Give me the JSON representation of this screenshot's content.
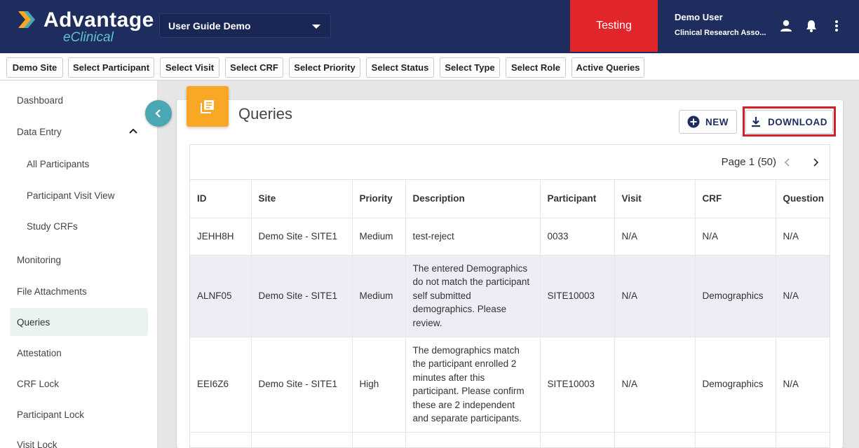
{
  "header": {
    "logo_main": "Advantage",
    "logo_sub": "eClinical",
    "study": "User Guide Demo",
    "environment": "Testing",
    "user_name": "Demo User",
    "user_role": "Clinical Research Asso...",
    "icons": [
      "person-icon",
      "bell-icon",
      "more-vert-icon"
    ],
    "colors": {
      "header_bg": "#1e2d5e",
      "env_bg": "#e0252b",
      "accent": "#4aa8b4"
    }
  },
  "filters": [
    "Demo Site",
    "Select Participant",
    "Select Visit",
    "Select CRF",
    "Select Priority",
    "Select Status",
    "Select Type",
    "Select Role",
    "Active Queries"
  ],
  "sidebar": {
    "items": [
      {
        "label": "Dashboard"
      },
      {
        "label": "Data Entry"
      },
      {
        "label": "All Participants"
      },
      {
        "label": "Participant Visit View"
      },
      {
        "label": "Study CRFs"
      },
      {
        "label": "Monitoring"
      },
      {
        "label": "File Attachments"
      },
      {
        "label": "Queries"
      },
      {
        "label": "Attestation"
      },
      {
        "label": "CRF Lock"
      },
      {
        "label": "Participant Lock"
      },
      {
        "label": "Visit Lock"
      }
    ],
    "active": "Queries"
  },
  "main": {
    "title": "Queries",
    "new_label": "NEW",
    "download_label": "DOWNLOAD",
    "pager": "Page 1 (50)"
  },
  "table": {
    "columns": [
      "ID",
      "Site",
      "Priority",
      "Description",
      "Participant",
      "Visit",
      "CRF",
      "Question"
    ],
    "rows": [
      [
        "JEHH8H",
        "Demo Site - SITE1",
        "Medium",
        "test-reject",
        "0033",
        "N/A",
        "N/A",
        "N/A"
      ],
      [
        "ALNF05",
        "Demo Site - SITE1",
        "Medium",
        "The entered Demographics do not match the participant self submitted demographics. Please review.",
        "SITE10003",
        "N/A",
        "Demographics",
        "N/A"
      ],
      [
        "EEI6Z6",
        "Demo Site - SITE1",
        "High",
        "The demographics match the participant enrolled 2 minutes after this participant. Please confirm these are 2 independent and separate participants.",
        "SITE10003",
        "N/A",
        "Demographics",
        "N/A"
      ]
    ]
  }
}
